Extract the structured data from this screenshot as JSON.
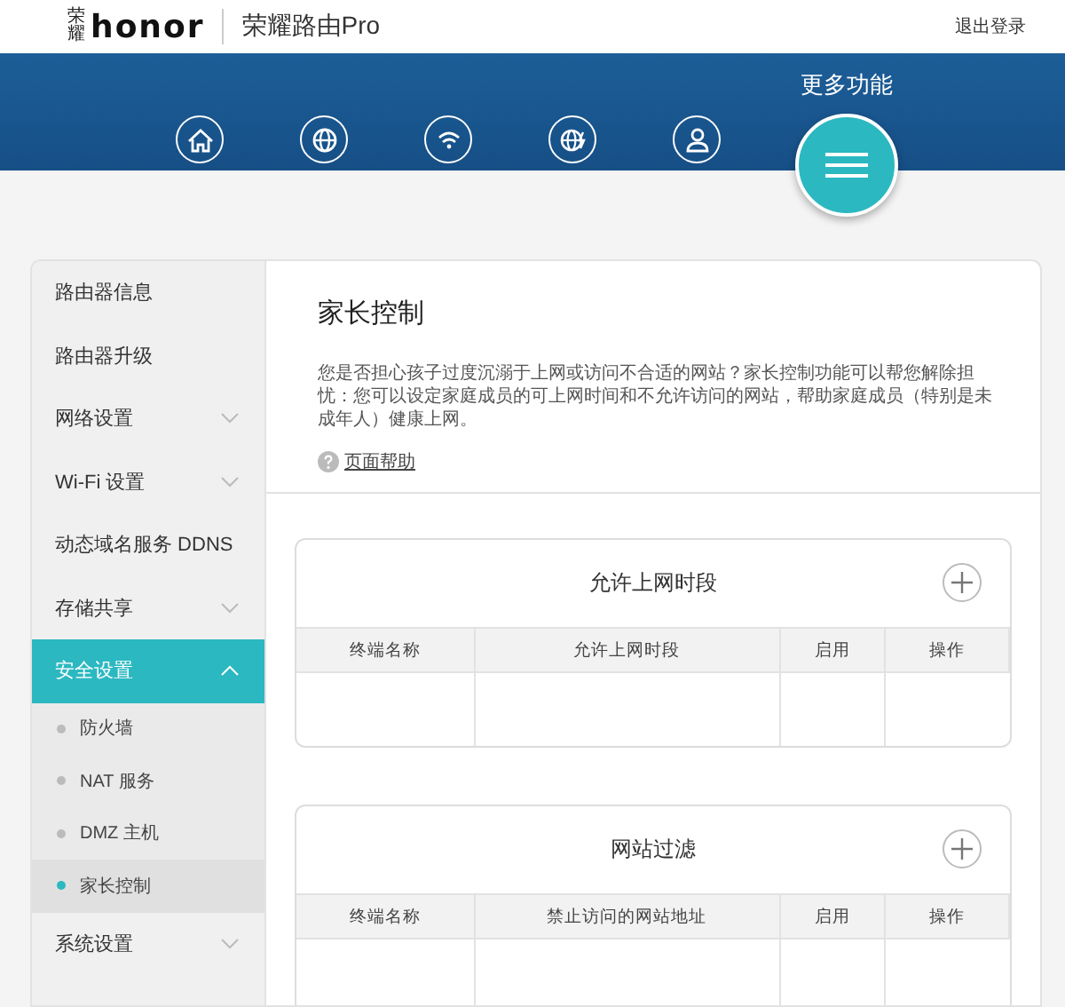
{
  "header": {
    "logo_mark": "荣耀",
    "logo": "honor",
    "product": "荣耀路由Pro",
    "logout": "退出登录"
  },
  "nav": {
    "more_label": "更多功能",
    "items": [
      {
        "kind": "home",
        "selected": false
      },
      {
        "kind": "globe",
        "selected": false
      },
      {
        "kind": "wifi",
        "selected": false
      },
      {
        "kind": "globe-bolt",
        "selected": false
      },
      {
        "kind": "user",
        "selected": false
      },
      {
        "kind": "menu",
        "selected": true
      }
    ]
  },
  "sidebar": {
    "items": [
      {
        "kind": "link",
        "label": "路由器信息",
        "selected": false
      },
      {
        "kind": "link",
        "label": "路由器升级",
        "selected": false
      },
      {
        "kind": "group",
        "label": "网络设置",
        "expanded": false,
        "selected": false
      },
      {
        "kind": "group",
        "label": "Wi-Fi 设置",
        "expanded": false,
        "selected": false
      },
      {
        "kind": "link",
        "label": "动态域名服务 DDNS",
        "selected": false
      },
      {
        "kind": "group",
        "label": "存储共享",
        "expanded": false,
        "selected": false
      },
      {
        "kind": "group",
        "label": "安全设置",
        "expanded": true,
        "selected": true,
        "children": [
          {
            "label": "防火墙",
            "selected": false
          },
          {
            "label": "NAT 服务",
            "selected": false
          },
          {
            "label": "DMZ 主机",
            "selected": false
          },
          {
            "label": "家长控制",
            "selected": true
          }
        ]
      },
      {
        "kind": "group",
        "label": "系统设置",
        "expanded": false,
        "selected": false
      }
    ]
  },
  "content": {
    "title": "家长控制",
    "description": "您是否担心孩子过度沉溺于上网或访问不合适的网站？家长控制功能可以帮您解除担忧：您可以设定家庭成员的可上网时间和不允许访问的网站，帮助家庭成员（特别是未成年人）健康上网。",
    "help_link": "页面帮助",
    "cards": [
      {
        "title": "允许上网时段",
        "columns": [
          "终端名称",
          "允许上网时段",
          "启用",
          "操作"
        ]
      },
      {
        "title": "网站过滤",
        "columns": [
          "终端名称",
          "禁止访问的网站地址",
          "启用",
          "操作"
        ]
      }
    ]
  }
}
